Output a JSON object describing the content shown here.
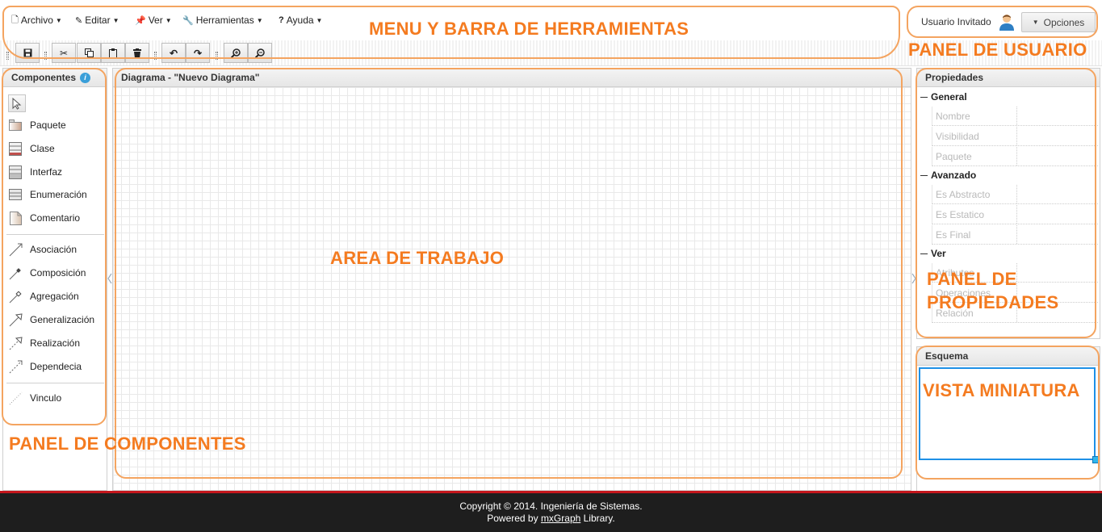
{
  "menu": {
    "items": [
      {
        "label": "Archivo",
        "icon": "file-icon"
      },
      {
        "label": "Editar",
        "icon": "pencil-icon"
      },
      {
        "label": "Ver",
        "icon": "pin-icon"
      },
      {
        "label": "Herramientas",
        "icon": "wrench-icon"
      },
      {
        "label": "Ayuda",
        "icon": "question-icon"
      }
    ]
  },
  "user": {
    "name": "Usuario Invitado",
    "options_label": "Opciones"
  },
  "toolbar": {
    "buttons": [
      "save-icon",
      "cut-icon",
      "copy-icon",
      "paste-icon",
      "delete-icon",
      "undo-icon",
      "redo-icon",
      "zoom-in-icon",
      "zoom-out-icon"
    ]
  },
  "components": {
    "title": "Componentes",
    "items": [
      {
        "label": "Paquete",
        "icon": "package-icon"
      },
      {
        "label": "Clase",
        "icon": "class-icon"
      },
      {
        "label": "Interfaz",
        "icon": "interface-icon"
      },
      {
        "label": "Enumeración",
        "icon": "enumeration-icon"
      },
      {
        "label": "Comentario",
        "icon": "comment-icon"
      },
      {
        "label": "Asociación",
        "icon": "association-icon"
      },
      {
        "label": "Composición",
        "icon": "composition-icon"
      },
      {
        "label": "Agregación",
        "icon": "aggregation-icon"
      },
      {
        "label": "Generalización",
        "icon": "generalization-icon"
      },
      {
        "label": "Realización",
        "icon": "realization-icon"
      },
      {
        "label": "Dependecia",
        "icon": "dependency-icon"
      },
      {
        "label": "Vinculo",
        "icon": "link-icon"
      }
    ]
  },
  "diagram": {
    "title": "Diagrama - \"Nuevo Diagrama\""
  },
  "properties": {
    "title": "Propiedades",
    "groups": [
      {
        "label": "General",
        "rows": [
          "Nombre",
          "Visibilidad",
          "Paquete"
        ]
      },
      {
        "label": "Avanzado",
        "rows": [
          "Es Abstracto",
          "Es Estatico",
          "Es Final"
        ]
      },
      {
        "label": "Ver",
        "rows": [
          "Atributos",
          "Operaciones",
          "Relación"
        ]
      }
    ]
  },
  "outline": {
    "title": "Esquema"
  },
  "footer": {
    "line1": "Copyright © 2014. Ingeniería de Sistemas.",
    "powered_prefix": "Powered by ",
    "powered_link": "mxGraph",
    "powered_suffix": " Library."
  },
  "annotations": {
    "menu_toolbar": "MENU Y BARRA DE HERRAMIENTAS",
    "user_panel": "PANEL DE USUARIO",
    "work_area": "AREA DE TRABAJO",
    "props_panel_1": "PANEL DE",
    "props_panel_2": "PROPIEDADES",
    "thumbnail": "VISTA MINIATURA",
    "components_panel": "PANEL DE COMPONENTES"
  },
  "colors": {
    "annotation": "#f47b20",
    "footer_bg": "#1e1e1e",
    "footer_accent": "#c4161c",
    "outline_box": "#1e90e6"
  }
}
